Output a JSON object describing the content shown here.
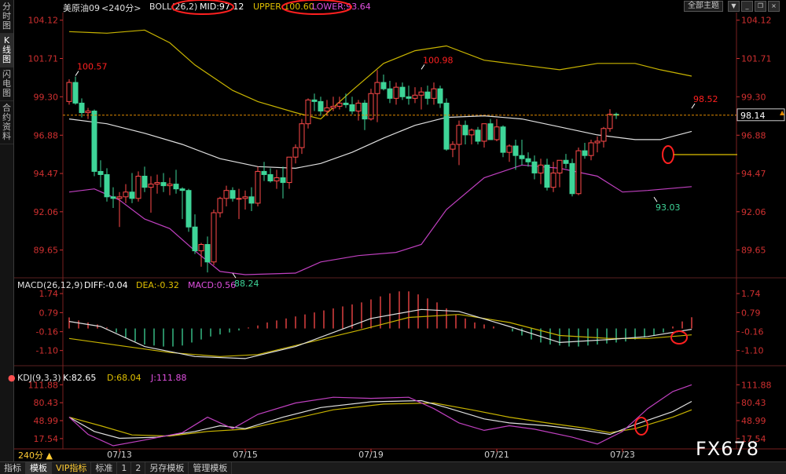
{
  "app": {
    "sidebar_tabs": [
      "分时图",
      "K线图",
      "闪电图",
      "合约资料"
    ],
    "active_tab": 1,
    "period_label": "240分 ▲",
    "theme_select": "全部主题",
    "bottom_tabs": [
      "指标",
      "模板",
      "VIP指标",
      "标准",
      "1",
      "2",
      "另存模板",
      "管理模板"
    ],
    "bottom_active": 1,
    "watermark": "FX678"
  },
  "main_legend": {
    "symbol": "美原油09",
    "period": "<240分>",
    "boll": "BOLL(26,2)",
    "mid": "MID:97.12",
    "upper": "UPPER:100.60",
    "lower": "LOWER:93.64"
  },
  "macd_legend": {
    "params": "MACD(26,12,9)",
    "diff": "DIFF:-0.04",
    "dea": "DEA:-0.32",
    "macd": "MACD:0.56"
  },
  "kdj_legend": {
    "params": "KDJ(9,3,3)",
    "k": "K:82.65",
    "d": "D:68.04",
    "j": "J:111.88"
  },
  "colors": {
    "up": "#ff4a4a",
    "down": "#3ed598",
    "mid": "#e0e0e0",
    "upper": "#c8b400",
    "lower": "#c040c0",
    "axis": "#d03030",
    "annotation": "#ff2020"
  },
  "chart_data": {
    "type": "candlestick",
    "x_labels": [
      "07/13",
      "07/15",
      "07/19",
      "07/21",
      "07/23"
    ],
    "x_label_index": [
      8,
      28,
      48,
      68,
      88
    ],
    "price_axis": {
      "ticks": [
        104.12,
        101.71,
        99.3,
        96.88,
        94.47,
        92.06,
        89.65
      ],
      "range": [
        88.0,
        104.7
      ],
      "last_price_label": "98.14",
      "last_price": 98.14
    },
    "annotations": [
      {
        "label": "100.57",
        "index": 1,
        "value": 100.57,
        "kind": "high"
      },
      {
        "label": "88.24",
        "index": 26,
        "value": 88.24,
        "kind": "low"
      },
      {
        "label": "100.98",
        "index": 56,
        "value": 100.98,
        "kind": "high"
      },
      {
        "label": "93.03",
        "index": 93,
        "value": 93.03,
        "kind": "low"
      },
      {
        "label": "98.52",
        "index": 99,
        "value": 98.52,
        "kind": "high"
      }
    ],
    "ohlc": [
      [
        99.0,
        100.4,
        98.8,
        100.2
      ],
      [
        100.2,
        100.57,
        98.8,
        98.9
      ],
      [
        98.9,
        99.2,
        98.0,
        98.3
      ],
      [
        98.3,
        98.6,
        97.9,
        98.4
      ],
      [
        98.4,
        98.5,
        94.3,
        94.6
      ],
      [
        94.6,
        95.3,
        93.6,
        94.4
      ],
      [
        94.4,
        94.8,
        92.7,
        93.0
      ],
      [
        93.0,
        93.6,
        92.3,
        92.9
      ],
      [
        92.9,
        93.3,
        91.1,
        93.0
      ],
      [
        93.0,
        93.8,
        92.6,
        93.3
      ],
      [
        93.3,
        94.5,
        92.6,
        92.9
      ],
      [
        92.9,
        94.6,
        92.7,
        94.3
      ],
      [
        94.3,
        94.9,
        93.3,
        93.6
      ],
      [
        93.6,
        94.3,
        92.0,
        93.8
      ],
      [
        93.8,
        94.4,
        93.2,
        93.9
      ],
      [
        93.9,
        94.5,
        93.3,
        93.7
      ],
      [
        93.7,
        94.2,
        93.1,
        93.8
      ],
      [
        93.8,
        94.7,
        93.2,
        93.5
      ],
      [
        93.5,
        93.6,
        91.6,
        93.4
      ],
      [
        93.4,
        93.5,
        90.8,
        91.1
      ],
      [
        91.1,
        91.9,
        89.4,
        89.6
      ],
      [
        89.6,
        90.1,
        88.6,
        90.0
      ],
      [
        90.0,
        90.5,
        88.24,
        88.9
      ],
      [
        88.9,
        92.2,
        88.7,
        92.0
      ],
      [
        92.0,
        93.0,
        91.7,
        92.9
      ],
      [
        92.9,
        93.7,
        92.4,
        93.4
      ],
      [
        93.4,
        93.6,
        92.7,
        92.9
      ],
      [
        92.9,
        93.5,
        91.6,
        92.9
      ],
      [
        92.9,
        93.4,
        92.2,
        93.0
      ],
      [
        93.0,
        93.6,
        92.1,
        92.6
      ],
      [
        92.6,
        94.9,
        92.4,
        94.6
      ],
      [
        94.6,
        95.2,
        94.0,
        94.4
      ],
      [
        94.4,
        94.8,
        93.9,
        94.0
      ],
      [
        94.0,
        94.7,
        93.5,
        94.2
      ],
      [
        94.2,
        94.9,
        92.9,
        93.9
      ],
      [
        93.9,
        95.5,
        93.5,
        95.5
      ],
      [
        95.5,
        96.3,
        95.1,
        96.1
      ],
      [
        96.1,
        97.9,
        95.7,
        97.6
      ],
      [
        97.6,
        99.2,
        97.3,
        99.1
      ],
      [
        99.1,
        99.5,
        98.4,
        99.0
      ],
      [
        99.0,
        99.3,
        98.1,
        98.4
      ],
      [
        98.4,
        99.1,
        98.1,
        98.6
      ],
      [
        98.6,
        99.3,
        98.4,
        98.7
      ],
      [
        98.7,
        99.3,
        98.5,
        98.9
      ],
      [
        98.9,
        99.5,
        98.6,
        98.8
      ],
      [
        98.8,
        99.3,
        98.2,
        98.4
      ],
      [
        98.4,
        99.1,
        97.8,
        98.9
      ],
      [
        98.9,
        99.1,
        97.2,
        97.9
      ],
      [
        97.9,
        99.8,
        97.8,
        99.5
      ],
      [
        99.5,
        100.98,
        97.7,
        100.2
      ],
      [
        100.2,
        100.7,
        99.7,
        99.8
      ],
      [
        99.8,
        100.3,
        98.9,
        99.2
      ],
      [
        99.2,
        100.2,
        98.8,
        99.9
      ],
      [
        99.9,
        100.2,
        99.1,
        99.3
      ],
      [
        99.3,
        100.0,
        98.8,
        99.2
      ],
      [
        99.2,
        99.9,
        98.9,
        99.4
      ],
      [
        99.4,
        99.9,
        98.5,
        99.6
      ],
      [
        99.6,
        100.0,
        98.8,
        99.2
      ],
      [
        99.2,
        100.2,
        98.8,
        99.8
      ],
      [
        99.8,
        100.0,
        98.6,
        98.9
      ],
      [
        98.9,
        99.2,
        95.9,
        96.0
      ],
      [
        96.0,
        96.5,
        95.5,
        96.3
      ],
      [
        96.3,
        97.8,
        95.0,
        97.5
      ],
      [
        97.5,
        97.8,
        96.3,
        96.9
      ],
      [
        96.9,
        97.3,
        96.3,
        97.2
      ],
      [
        97.2,
        97.4,
        96.3,
        96.5
      ],
      [
        96.5,
        97.6,
        96.1,
        97.6
      ],
      [
        97.6,
        97.9,
        96.6,
        96.6
      ],
      [
        96.6,
        97.9,
        96.5,
        97.4
      ],
      [
        97.4,
        97.5,
        95.5,
        95.8
      ],
      [
        95.8,
        96.3,
        95.2,
        96.2
      ],
      [
        96.2,
        96.6,
        94.7,
        95.6
      ],
      [
        95.6,
        96.6,
        95.0,
        95.4
      ],
      [
        95.4,
        95.8,
        94.9,
        95.2
      ],
      [
        95.2,
        95.6,
        94.1,
        94.5
      ],
      [
        94.5,
        95.4,
        93.8,
        95.0
      ],
      [
        95.0,
        95.4,
        93.4,
        93.6
      ],
      [
        93.6,
        95.2,
        93.3,
        94.5
      ],
      [
        94.5,
        95.3,
        93.6,
        95.3
      ],
      [
        95.3,
        95.7,
        94.8,
        95.1
      ],
      [
        95.1,
        95.4,
        93.03,
        93.2
      ],
      [
        93.2,
        96.1,
        93.1,
        95.9
      ],
      [
        95.9,
        96.4,
        95.4,
        95.6
      ],
      [
        95.6,
        96.6,
        95.3,
        96.4
      ],
      [
        96.4,
        96.8,
        95.8,
        96.5
      ],
      [
        96.5,
        97.4,
        96.1,
        97.3
      ],
      [
        97.3,
        98.52,
        97.1,
        98.2
      ],
      [
        98.2,
        98.3,
        97.9,
        98.14
      ]
    ],
    "boll_mid": [
      [
        0,
        97.9
      ],
      [
        6,
        97.6
      ],
      [
        12,
        97.0
      ],
      [
        18,
        96.3
      ],
      [
        24,
        95.4
      ],
      [
        30,
        94.9
      ],
      [
        36,
        94.8
      ],
      [
        40,
        95.1
      ],
      [
        45,
        95.8
      ],
      [
        50,
        96.7
      ],
      [
        55,
        97.5
      ],
      [
        60,
        98.0
      ],
      [
        66,
        98.1
      ],
      [
        72,
        97.9
      ],
      [
        78,
        97.4
      ],
      [
        84,
        96.9
      ],
      [
        90,
        96.6
      ],
      [
        94,
        96.6
      ],
      [
        99,
        97.12
      ]
    ],
    "boll_upper": [
      [
        0,
        103.4
      ],
      [
        6,
        103.3
      ],
      [
        12,
        103.5
      ],
      [
        16,
        102.7
      ],
      [
        20,
        101.3
      ],
      [
        26,
        99.7
      ],
      [
        30,
        99.0
      ],
      [
        36,
        98.3
      ],
      [
        40,
        97.9
      ],
      [
        45,
        99.7
      ],
      [
        50,
        101.4
      ],
      [
        55,
        102.2
      ],
      [
        60,
        102.5
      ],
      [
        66,
        101.6
      ],
      [
        72,
        101.3
      ],
      [
        78,
        101.0
      ],
      [
        84,
        101.4
      ],
      [
        90,
        101.4
      ],
      [
        94,
        101.0
      ],
      [
        99,
        100.6
      ]
    ],
    "boll_lower": [
      [
        0,
        93.3
      ],
      [
        4,
        93.5
      ],
      [
        8,
        92.8
      ],
      [
        12,
        91.6
      ],
      [
        16,
        91.0
      ],
      [
        20,
        89.6
      ],
      [
        24,
        88.3
      ],
      [
        28,
        88.1
      ],
      [
        36,
        88.2
      ],
      [
        40,
        88.9
      ],
      [
        46,
        89.3
      ],
      [
        52,
        89.5
      ],
      [
        56,
        90.0
      ],
      [
        60,
        92.2
      ],
      [
        66,
        94.2
      ],
      [
        72,
        95.0
      ],
      [
        78,
        94.8
      ],
      [
        84,
        94.3
      ],
      [
        88,
        93.3
      ],
      [
        92,
        93.4
      ],
      [
        99,
        93.64
      ]
    ],
    "macd": {
      "ticks": [
        1.74,
        0.79,
        -0.16,
        -1.1
      ],
      "hist": [
        0.55,
        0.4,
        0.3,
        0.2,
        0.05,
        -0.2,
        -0.45,
        -0.65,
        -0.8,
        -0.85,
        -0.9,
        -0.9,
        -0.85,
        -0.7,
        -0.55,
        -0.4,
        -0.3,
        -0.2,
        -0.1,
        0.05,
        0.15,
        0.3,
        0.4,
        0.5,
        0.6,
        0.7,
        0.8,
        0.9,
        1.0,
        1.1,
        1.2,
        1.3,
        1.45,
        1.6,
        1.75,
        1.85,
        1.85,
        1.7,
        1.5,
        1.3,
        1.0,
        0.7,
        0.5,
        0.3,
        0.2,
        0.1,
        0.0,
        -0.15,
        -0.35,
        -0.55,
        -0.7,
        -0.8,
        -0.85,
        -0.9,
        -0.9,
        -0.85,
        -0.8,
        -0.75,
        -0.7,
        -0.65,
        -0.55,
        -0.45,
        -0.35,
        -0.2,
        0.1,
        0.35,
        0.56
      ],
      "hist_start": 0,
      "hist_step": 1.5,
      "diff": [
        [
          0,
          0.35
        ],
        [
          5,
          0.1
        ],
        [
          12,
          -0.9
        ],
        [
          20,
          -1.4
        ],
        [
          28,
          -1.5
        ],
        [
          36,
          -0.9
        ],
        [
          42,
          -0.2
        ],
        [
          48,
          0.5
        ],
        [
          56,
          0.95
        ],
        [
          62,
          0.85
        ],
        [
          70,
          0.1
        ],
        [
          78,
          -0.7
        ],
        [
          86,
          -0.55
        ],
        [
          92,
          -0.4
        ],
        [
          99,
          -0.04
        ]
      ],
      "dea": [
        [
          0,
          -0.5
        ],
        [
          8,
          -0.85
        ],
        [
          16,
          -1.2
        ],
        [
          24,
          -1.4
        ],
        [
          30,
          -1.3
        ],
        [
          38,
          -0.7
        ],
        [
          46,
          -0.1
        ],
        [
          54,
          0.55
        ],
        [
          62,
          0.7
        ],
        [
          70,
          0.3
        ],
        [
          78,
          -0.35
        ],
        [
          86,
          -0.5
        ],
        [
          92,
          -0.5
        ],
        [
          99,
          -0.32
        ]
      ]
    },
    "kdj": {
      "ticks": [
        111.88,
        80.43,
        48.99,
        17.54
      ],
      "k": [
        [
          0,
          55
        ],
        [
          4,
          30
        ],
        [
          8,
          18
        ],
        [
          14,
          20
        ],
        [
          20,
          30
        ],
        [
          24,
          40
        ],
        [
          28,
          35
        ],
        [
          34,
          55
        ],
        [
          40,
          72
        ],
        [
          48,
          82
        ],
        [
          56,
          84
        ],
        [
          60,
          72
        ],
        [
          66,
          52
        ],
        [
          70,
          45
        ],
        [
          76,
          40
        ],
        [
          82,
          32
        ],
        [
          86,
          25
        ],
        [
          90,
          42
        ],
        [
          96,
          65
        ],
        [
          99,
          82.65
        ]
      ],
      "d": [
        [
          0,
          55
        ],
        [
          5,
          40
        ],
        [
          10,
          24
        ],
        [
          16,
          22
        ],
        [
          22,
          30
        ],
        [
          28,
          34
        ],
        [
          34,
          48
        ],
        [
          42,
          68
        ],
        [
          50,
          78
        ],
        [
          58,
          80
        ],
        [
          64,
          68
        ],
        [
          70,
          55
        ],
        [
          76,
          45
        ],
        [
          82,
          36
        ],
        [
          86,
          28
        ],
        [
          90,
          35
        ],
        [
          96,
          55
        ],
        [
          99,
          68.04
        ]
      ],
      "j": [
        [
          0,
          55
        ],
        [
          3,
          25
        ],
        [
          7,
          5
        ],
        [
          12,
          15
        ],
        [
          18,
          28
        ],
        [
          22,
          55
        ],
        [
          26,
          35
        ],
        [
          30,
          60
        ],
        [
          36,
          80
        ],
        [
          42,
          90
        ],
        [
          48,
          88
        ],
        [
          54,
          90
        ],
        [
          58,
          70
        ],
        [
          62,
          45
        ],
        [
          66,
          32
        ],
        [
          70,
          40
        ],
        [
          74,
          34
        ],
        [
          80,
          20
        ],
        [
          84,
          8
        ],
        [
          88,
          30
        ],
        [
          92,
          70
        ],
        [
          96,
          100
        ],
        [
          99,
          111.88
        ]
      ]
    }
  }
}
